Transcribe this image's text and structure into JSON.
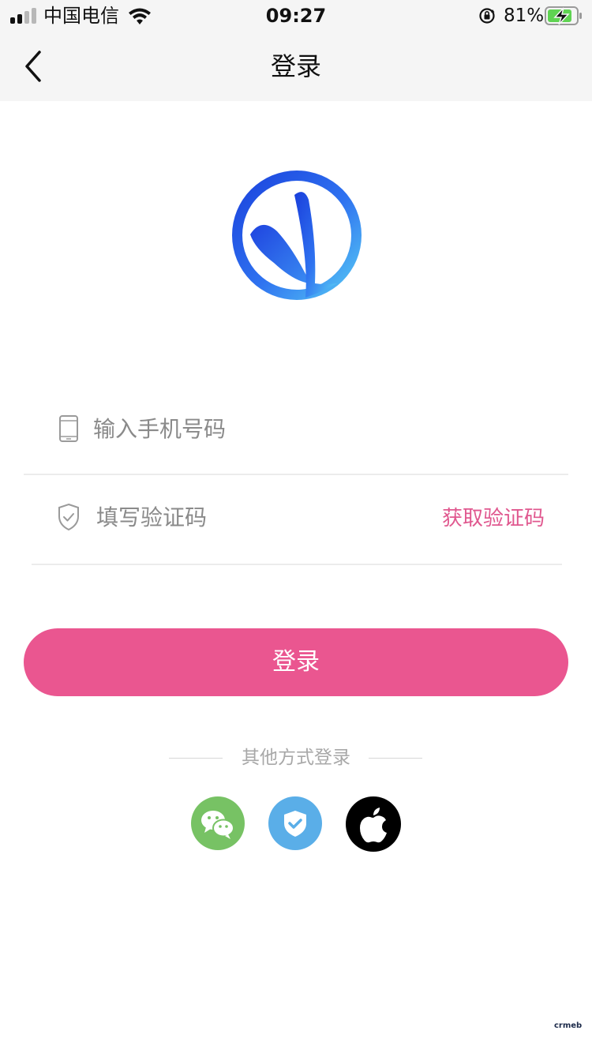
{
  "status_bar": {
    "carrier": "中国电信",
    "time": "09:27",
    "battery_percent": "81%",
    "signal_bars_filled": 2,
    "signal_bars_total": 4
  },
  "nav": {
    "title": "登录",
    "back_icon": "chevron-left-icon"
  },
  "form": {
    "phone_placeholder": "输入手机号码",
    "phone_value": "",
    "code_placeholder": "填写验证码",
    "code_value": "",
    "get_code_label": "获取验证码"
  },
  "login_button": {
    "label": "登录"
  },
  "other_login": {
    "label": "其他方式登录",
    "options": [
      {
        "icon": "wechat-icon"
      },
      {
        "icon": "shield-check-icon"
      },
      {
        "icon": "apple-icon"
      }
    ]
  },
  "watermark": "crmeb",
  "colors": {
    "accent": "#ea5690",
    "link": "#e0588f",
    "wechat": "#77c264",
    "shield": "#5aaee8",
    "apple": "#000000",
    "bar_bg": "#f5f5f5"
  }
}
